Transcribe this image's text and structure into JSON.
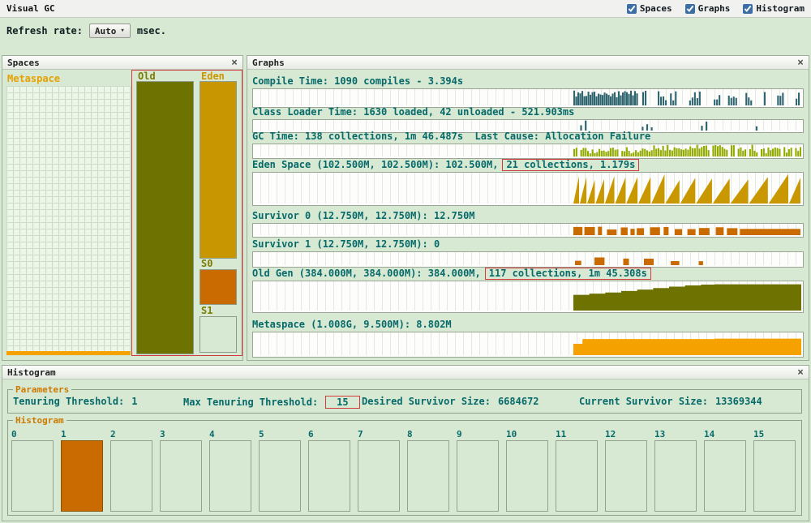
{
  "ui": {
    "close_glyph": "×",
    "dropdown_arrow": "▾",
    "accent_red": "#d23b3b",
    "teal_text": "#076a6a",
    "orange_accent": "#cc7a00"
  },
  "title_bar": {
    "title": "Visual GC",
    "checkboxes": [
      {
        "label": "Spaces",
        "checked": true
      },
      {
        "label": "Graphs",
        "checked": true
      },
      {
        "label": "Histogram",
        "checked": true
      }
    ]
  },
  "toolbar": {
    "refresh_label": "Refresh rate:",
    "refresh_value": "Auto",
    "units": "msec."
  },
  "spaces": {
    "title": "Spaces",
    "metaspace_label": "Metaspace",
    "old_label": "Old",
    "eden_label": "Eden",
    "s0_label": "S0",
    "s1_label": "S1",
    "old_fill": "#6e7200",
    "eden_fill": "#c89600",
    "s0_fill": "#c96b00",
    "metaspace_used_fill": "#f5a200"
  },
  "graphs": {
    "title": "Graphs",
    "rows": [
      {
        "label": "Compile Time: 1090 compiles - 3.394s",
        "boxed": "",
        "pattern": "compile",
        "color": "#2e6570",
        "seed": 11
      },
      {
        "label": "Class Loader Time: 1630 loaded, 42 unloaded - 521.903ms",
        "boxed": "",
        "pattern": "sparse",
        "color": "#2e6570",
        "seed": 22
      },
      {
        "label": "GC Time: 138 collections, 1m 46.487s  Last Cause: Allocation Failure",
        "boxed": "",
        "pattern": "gc",
        "color": "#93ab00",
        "seed": 33
      },
      {
        "label": "Eden Space (102.500M, 102.500M): 102.500M,",
        "boxed": "21 collections, 1.179s",
        "pattern": "sawtooth",
        "color": "#c99700",
        "seed": 44
      },
      {
        "label": "Survivor 0 (12.750M, 12.750M): 12.750M",
        "boxed": "",
        "pattern": "blocks",
        "color": "#c96b00",
        "seed": 55
      },
      {
        "label": "Survivor 1 (12.750M, 12.750M): 0",
        "boxed": "",
        "pattern": "blocks-sparse",
        "color": "#c96b00",
        "seed": 66
      },
      {
        "label": "Old Gen (384.000M, 384.000M): 384.000M,",
        "boxed": "117 collections, 1m 45.308s",
        "pattern": "steps",
        "color": "#6e7200",
        "seed": 77
      },
      {
        "label": "Metaspace (1.008G, 9.500M): 8.802M",
        "boxed": "",
        "pattern": "flat",
        "color": "#f5a200",
        "seed": 88
      }
    ]
  },
  "histogram": {
    "title": "Histogram",
    "parameters": {
      "group_title": "Parameters",
      "items": [
        {
          "label": "Tenuring Threshold:",
          "value": "1",
          "boxed": false
        },
        {
          "label": "Max Tenuring Threshold:",
          "value": "15",
          "boxed": true
        },
        {
          "label": "Desired Survivor Size:",
          "value": "6684672",
          "boxed": false
        },
        {
          "label": "Current Survivor Size:",
          "value": "13369344",
          "boxed": false
        }
      ]
    },
    "bins": {
      "group_title": "Histogram",
      "labels": [
        "0",
        "1",
        "2",
        "3",
        "4",
        "5",
        "6",
        "7",
        "8",
        "9",
        "10",
        "11",
        "12",
        "13",
        "14",
        "15"
      ],
      "filled_index": 1,
      "filled_color": "#c96b00"
    }
  }
}
